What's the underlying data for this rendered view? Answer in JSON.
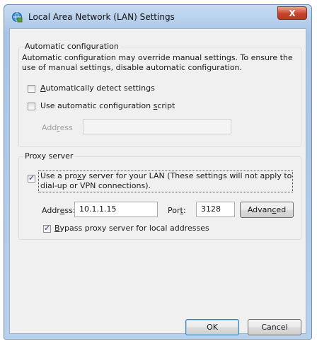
{
  "window": {
    "title": "Local Area Network (LAN) Settings",
    "close_glyph": "X"
  },
  "auto_config": {
    "legend": "Automatic configuration",
    "description": "Automatic configuration may override manual settings.  To ensure the use of manual settings, disable automatic configuration.",
    "detect_label": "Automatically detect settings",
    "detect_checked": false,
    "script_label": "Use automatic configuration script",
    "script_checked": false,
    "address_label": "Address",
    "address_value": ""
  },
  "proxy": {
    "legend": "Proxy server",
    "use_proxy_label": "Use a proxy server for your LAN (These settings will not apply to dial-up or VPN connections).",
    "use_proxy_checked": true,
    "address_label": "Address:",
    "address_value": "10.1.1.15",
    "port_label": "Port:",
    "port_value": "3128",
    "advanced_label": "Advanced",
    "bypass_label": "Bypass proxy server for local addresses",
    "bypass_checked": true
  },
  "buttons": {
    "ok_label": "OK",
    "cancel_label": "Cancel"
  },
  "colors": {
    "title_gradient_top": "#c7dcf1",
    "close_button": "#c8442a",
    "dialog_face": "#f0f0f0"
  }
}
